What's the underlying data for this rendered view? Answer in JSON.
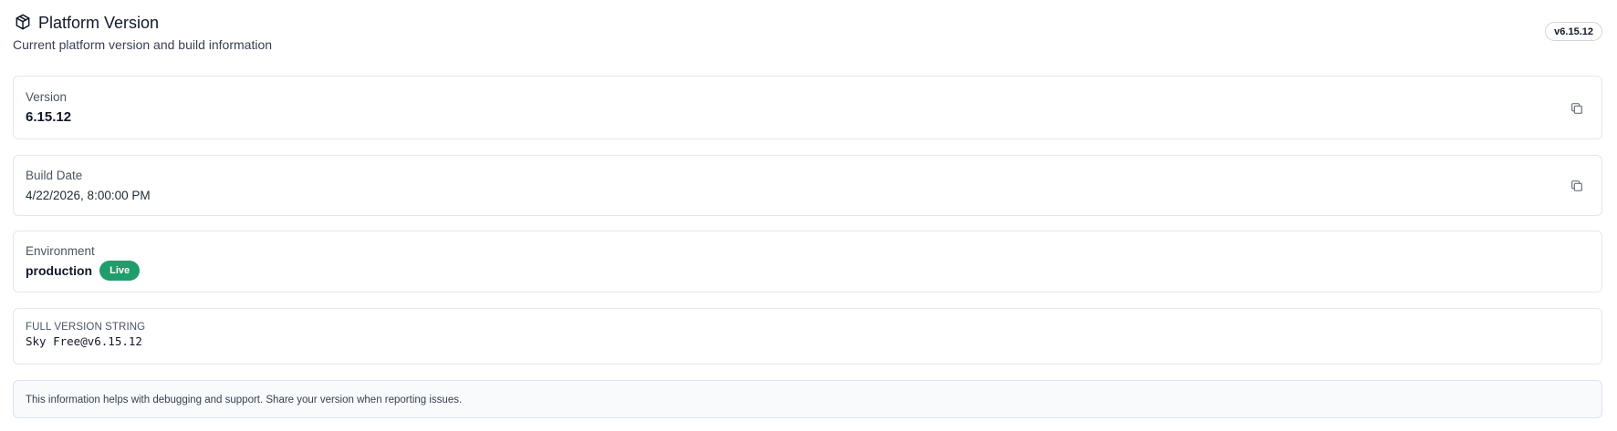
{
  "header": {
    "title": "Platform Version",
    "subtitle": "Current platform version and build information",
    "version_badge": "v6.15.12",
    "icon": "package-icon"
  },
  "cards": {
    "version": {
      "label": "Version",
      "value": "6.15.12",
      "action_icon": "copy-icon"
    },
    "build_date": {
      "label": "Build Date",
      "value": "4/22/2026, 8:00:00 PM",
      "action_icon": "copy-icon"
    },
    "environment": {
      "label": "Environment",
      "value": "production",
      "status_badge": "Live",
      "status_color": "#1f9d6b"
    },
    "full_version": {
      "label": "FULL VERSION STRING",
      "value": "Sky Free@v6.15.12"
    }
  },
  "footer_note": {
    "text": "This information helps with debugging and support. Share your version when reporting issues."
  }
}
